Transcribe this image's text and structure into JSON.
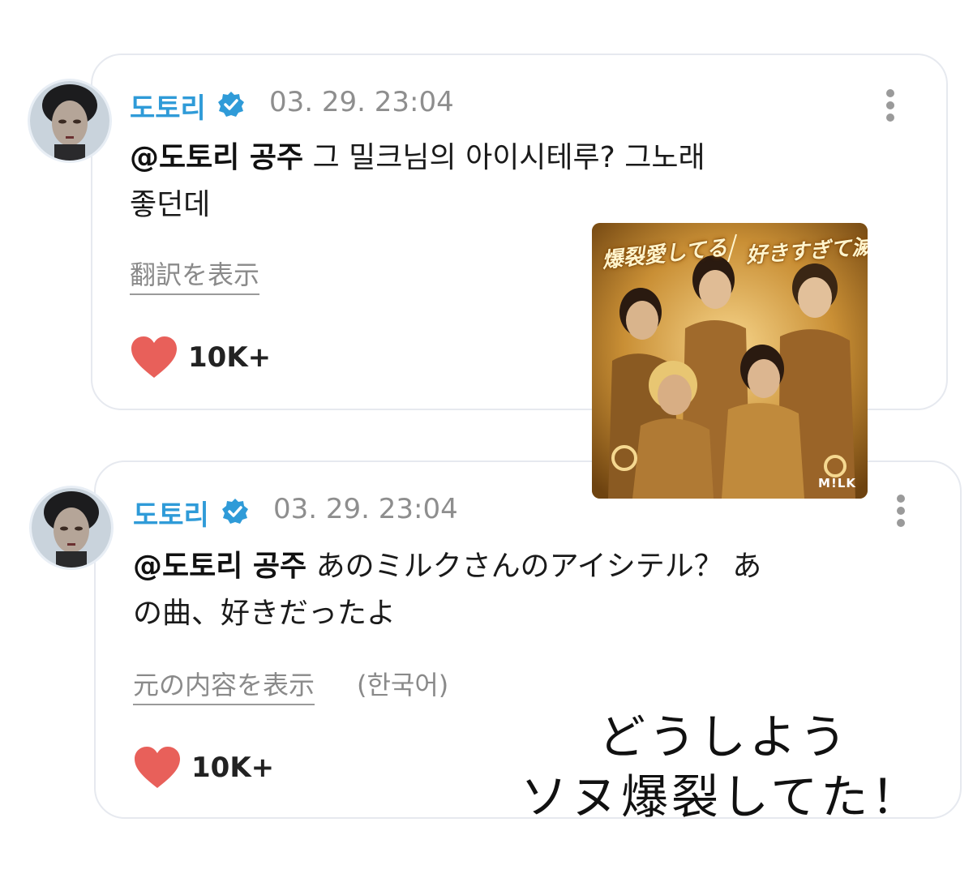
{
  "comments": [
    {
      "author": "도토리",
      "timestamp": "03. 29. 23:04",
      "mention": "@도토리 공주",
      "text_line1": " 그 밀크님의 아이시테루? 그노래",
      "text_line2": "좋던데",
      "translate_link": "翻訳を表示",
      "likes": "10K+"
    },
    {
      "author": "도토리",
      "timestamp": "03. 29. 23:04",
      "mention": "@도토리 공주",
      "text_line1": " あのミルクさんのアイシテル？ あ",
      "text_line2": "の曲、好きだったよ",
      "translate_link": "元の内容を表示",
      "lang_tag": "(한국어)",
      "likes": "10K+"
    }
  ],
  "album": {
    "title_left": "爆裂愛してる",
    "title_right": "好きすぎて滅!",
    "logo": "M!LK"
  },
  "caption": {
    "line1": "どうしよう",
    "line2": "ソヌ爆裂してた！"
  },
  "colors": {
    "author": "#2f9bd8",
    "verified": "#2f9bd8",
    "heart": "#e8605a",
    "card_border": "#e6e9ef"
  },
  "icons": [
    "verified-badge-icon",
    "more-vert-icon",
    "heart-icon"
  ]
}
